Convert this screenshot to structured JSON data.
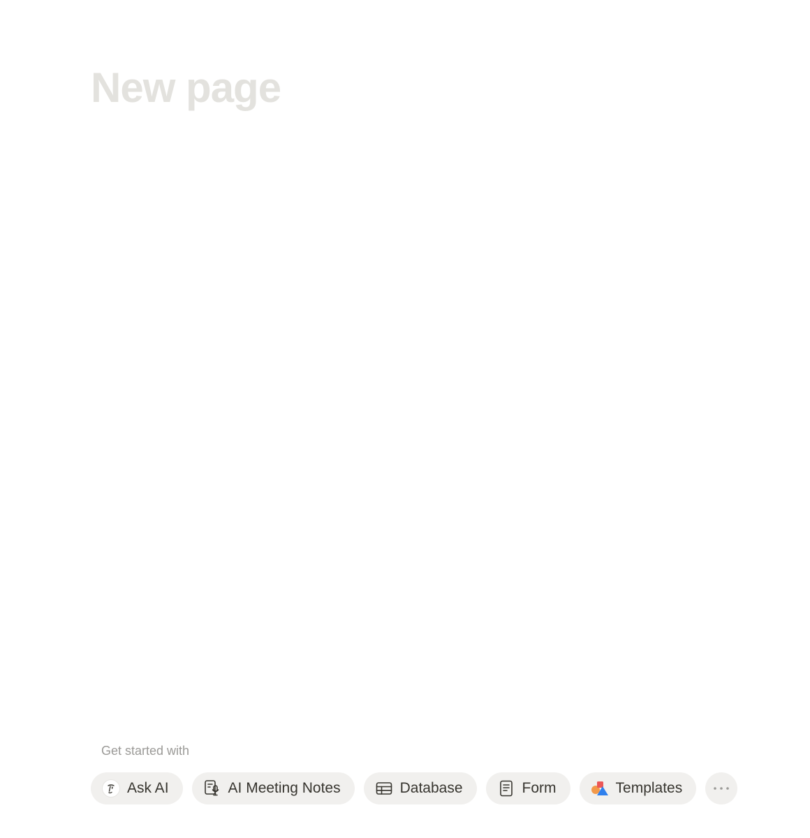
{
  "page": {
    "title": "New page"
  },
  "get_started": {
    "label": "Get started with",
    "chips": [
      {
        "label": "Ask AI",
        "icon": "ask-ai-face-icon"
      },
      {
        "label": "AI Meeting Notes",
        "icon": "meeting-notes-icon"
      },
      {
        "label": "Database",
        "icon": "table-icon"
      },
      {
        "label": "Form",
        "icon": "form-icon"
      },
      {
        "label": "Templates",
        "icon": "templates-shapes-icon"
      }
    ],
    "more_icon": "more-horizontal-icon"
  },
  "colors": {
    "title_placeholder": "#e3e2de",
    "chip_background": "#f1f0ee",
    "text_primary": "#37352f",
    "text_muted": "#9b9a97",
    "templates_red": "#eb5757",
    "templates_orange": "#f2994a",
    "templates_blue": "#2f80ed"
  }
}
